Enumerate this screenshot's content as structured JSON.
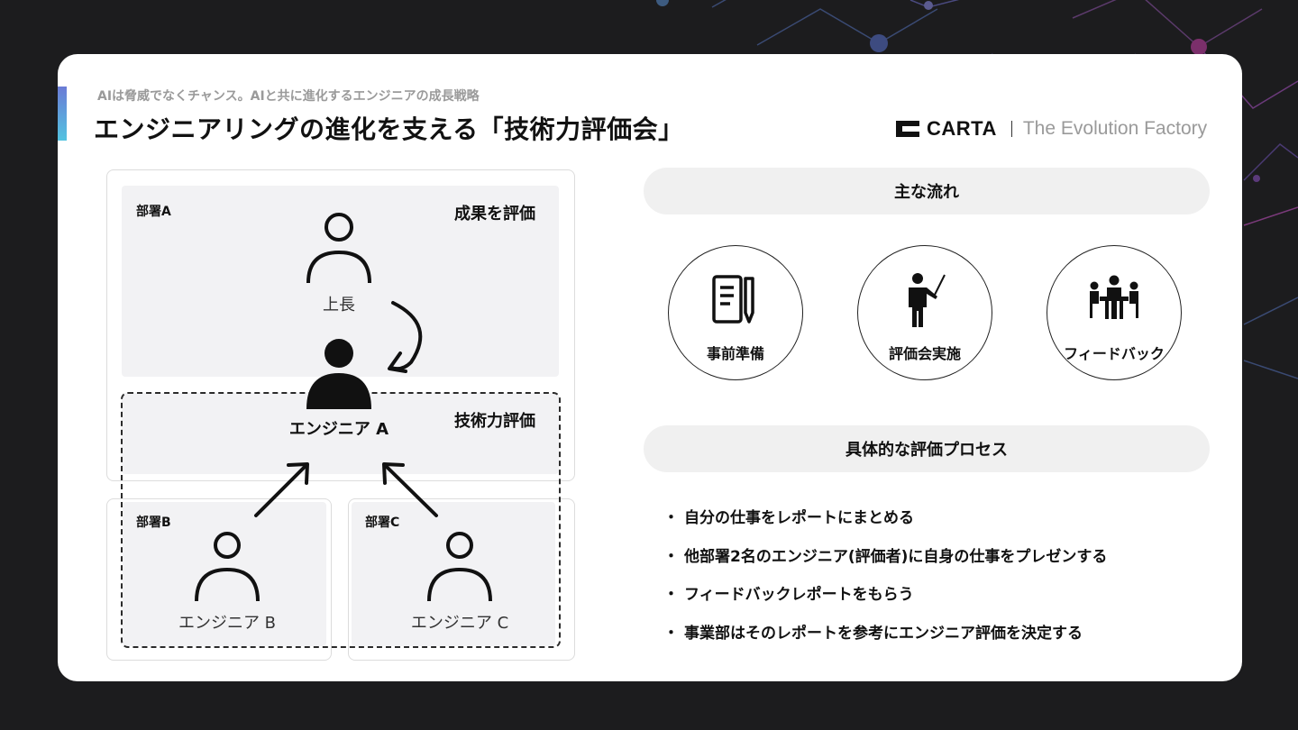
{
  "header": {
    "subtitle": "AIは脅威でなくチャンス。AIと共に進化するエンジニアの成長戦略",
    "title": "エンジニアリングの進化を支える「技術力評価会」"
  },
  "logo": {
    "brand": "CARTA",
    "tagline": "The Evolution Factory"
  },
  "diagram": {
    "dept_a": "部署A",
    "dept_b": "部署B",
    "dept_c": "部署C",
    "outcome_eval": "成果を評価",
    "tech_eval": "技術力評価",
    "boss": "上長",
    "engineer_a": "エンジニア A",
    "engineer_b": "エンジニア B",
    "engineer_c": "エンジニア C"
  },
  "flow": {
    "heading": "主な流れ",
    "steps": [
      {
        "label": "事前準備",
        "icon": "document-pencil-icon"
      },
      {
        "label": "評価会実施",
        "icon": "presenter-icon"
      },
      {
        "label": "フィードバック",
        "icon": "meeting-table-icon"
      }
    ]
  },
  "process": {
    "heading": "具体的な評価プロセス",
    "items": [
      "自分の仕事をレポートにまとめる",
      "他部署2名のエンジニア(評価者)に自身の仕事をプレゼンする",
      "フィードバックレポートをもらう",
      "事業部はそのレポートを参考にエンジニア評価を決定する"
    ],
    "bullet": "・"
  },
  "colors": {
    "background": "#1c1c1e",
    "card": "#ffffff",
    "accent_top": "#6b7bd6",
    "accent_bottom": "#53c3e0",
    "panel": "#f2f2f4",
    "pill": "#f0f0f0"
  }
}
